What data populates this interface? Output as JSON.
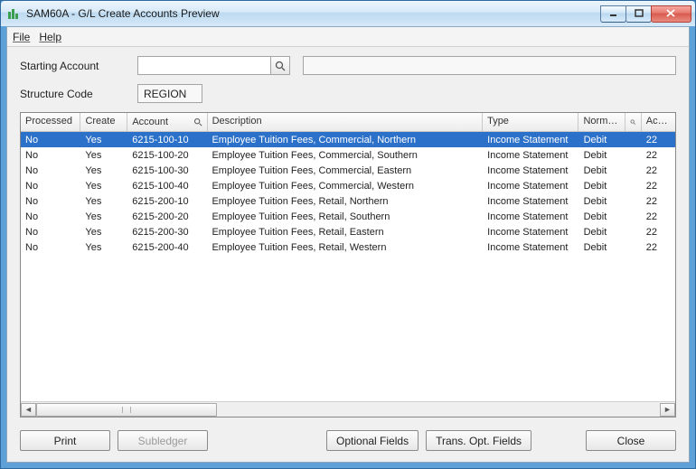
{
  "window": {
    "title": "SAM60A - G/L Create Accounts Preview"
  },
  "menu": {
    "file": "File",
    "help": "Help"
  },
  "form": {
    "starting_account_label": "Starting Account",
    "starting_account_value": "",
    "structure_code_label": "Structure Code",
    "structure_code_value": "REGION"
  },
  "grid": {
    "headers": {
      "processed": "Processed",
      "create": "Create",
      "account": "Account",
      "description": "Description",
      "type": "Type",
      "normal": "Normal ...",
      "account_type": "Acc..."
    },
    "rows": [
      {
        "processed": "No",
        "create": "Yes",
        "account": "6215-100-10",
        "description": "Employee Tuition Fees, Commercial, Northern",
        "type": "Income Statement",
        "normal": "Debit",
        "acct": "22",
        "selected": true
      },
      {
        "processed": "No",
        "create": "Yes",
        "account": "6215-100-20",
        "description": "Employee Tuition Fees, Commercial, Southern",
        "type": "Income Statement",
        "normal": "Debit",
        "acct": "22"
      },
      {
        "processed": "No",
        "create": "Yes",
        "account": "6215-100-30",
        "description": "Employee Tuition Fees, Commercial, Eastern",
        "type": "Income Statement",
        "normal": "Debit",
        "acct": "22"
      },
      {
        "processed": "No",
        "create": "Yes",
        "account": "6215-100-40",
        "description": "Employee Tuition Fees, Commercial, Western",
        "type": "Income Statement",
        "normal": "Debit",
        "acct": "22"
      },
      {
        "processed": "No",
        "create": "Yes",
        "account": "6215-200-10",
        "description": "Employee Tuition Fees, Retail, Northern",
        "type": "Income Statement",
        "normal": "Debit",
        "acct": "22"
      },
      {
        "processed": "No",
        "create": "Yes",
        "account": "6215-200-20",
        "description": "Employee Tuition Fees, Retail, Southern",
        "type": "Income Statement",
        "normal": "Debit",
        "acct": "22"
      },
      {
        "processed": "No",
        "create": "Yes",
        "account": "6215-200-30",
        "description": "Employee Tuition Fees, Retail, Eastern",
        "type": "Income Statement",
        "normal": "Debit",
        "acct": "22"
      },
      {
        "processed": "No",
        "create": "Yes",
        "account": "6215-200-40",
        "description": "Employee Tuition Fees, Retail, Western",
        "type": "Income Statement",
        "normal": "Debit",
        "acct": "22"
      }
    ]
  },
  "buttons": {
    "print": "Print",
    "subledger": "Subledger",
    "optional_fields": "Optional Fields",
    "trans_opt_fields": "Trans. Opt. Fields",
    "close": "Close"
  },
  "icons": {
    "magnifier": "magnifier-icon"
  }
}
